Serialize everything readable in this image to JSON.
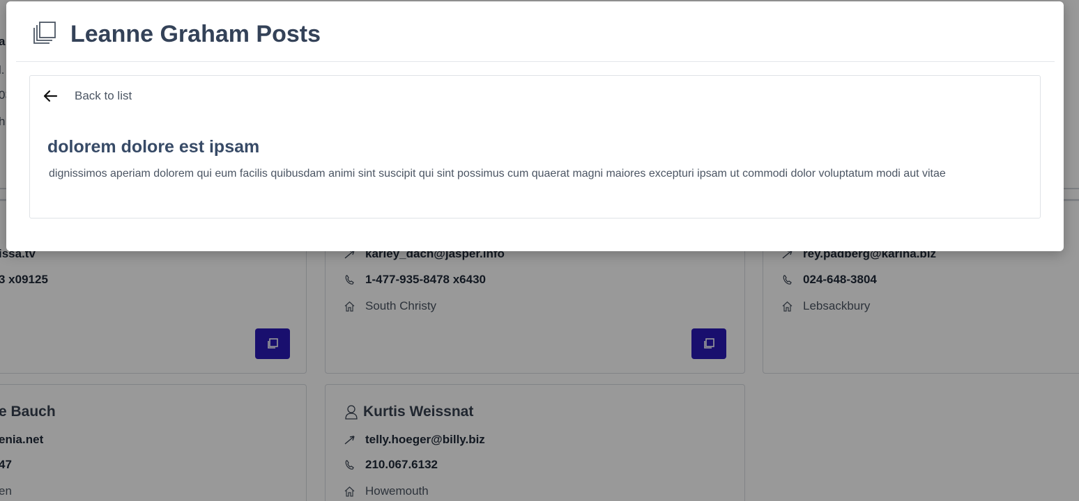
{
  "modal": {
    "title": "Leanne Graham Posts",
    "back_label": "Back to list",
    "post": {
      "title": "dolorem dolore est ipsam",
      "body": "dignissimos aperiam dolorem qui eum facilis quibusdam animi sint suscipit qui sint possimus cum quaerat magni maiores excepturi ipsam ut commodi dolor voluptatum modi aut vitae"
    }
  },
  "background": {
    "top_left_fragments": [
      "a",
      "l.",
      "03",
      "h"
    ],
    "cards": [
      {
        "email": "issa.tv",
        "phone": "3 x09125"
      },
      {
        "email": "karley_dach@jasper.info",
        "phone": "1-477-935-8478 x6430",
        "city": "South Christy"
      },
      {
        "email": "rey.padberg@karina.biz",
        "phone": "024-648-3804",
        "city": "Lebsackbury"
      },
      {
        "name": "e Bauch",
        "email": "enia.net",
        "phone": "47",
        "city": "en"
      },
      {
        "name": "Kurtis Weissnat",
        "email": "telly.hoeger@billy.biz",
        "phone": "210.067.6132",
        "city": "Howemouth"
      }
    ]
  },
  "colors": {
    "accent_button": "#2a1ab8",
    "overlay": "rgba(0,0,0,0.4)",
    "title_text": "#344258"
  }
}
